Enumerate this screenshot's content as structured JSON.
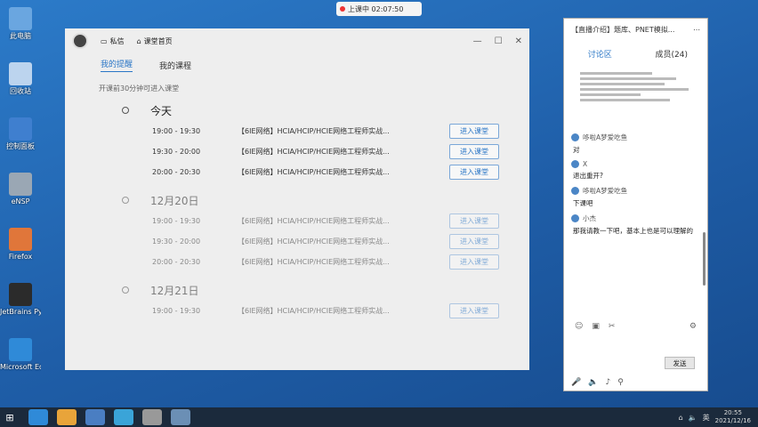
{
  "desktop_icons": [
    {
      "label": "此电脑",
      "color": "#6aa6e0"
    },
    {
      "label": "回收站",
      "color": "#bcd4ee"
    },
    {
      "label": "控制面板",
      "color": "#3f7fcf"
    },
    {
      "label": "eNSP",
      "color": "#9aa7b4"
    },
    {
      "label": "Firefox",
      "color": "#e0763a"
    },
    {
      "label": "JetBrains PyChar...",
      "color": "#2b2b2b"
    },
    {
      "label": "Microsoft Edge",
      "color": "#2f8ad8"
    }
  ],
  "live_indicator": {
    "text": "上课中 02:07:50"
  },
  "app": {
    "title_items": [
      {
        "icon": "message-icon",
        "label": "私信"
      },
      {
        "icon": "home-icon",
        "label": "课堂首页"
      }
    ],
    "tabs": [
      {
        "label": "我的提醒",
        "active": true
      },
      {
        "label": "我的课程",
        "active": false
      }
    ],
    "notice": "开课前30分钟可进入课堂",
    "enter_label": "进入课堂",
    "days": [
      {
        "title": "今天",
        "faded": false,
        "sessions": [
          {
            "time": "19:00 - 19:30",
            "title": "【6IE网络】HCIA/HCIP/HCIE网络工程师实战..."
          },
          {
            "time": "19:30 - 20:00",
            "title": "【6IE网络】HCIA/HCIP/HCIE网络工程师实战..."
          },
          {
            "time": "20:00 - 20:30",
            "title": "【6IE网络】HCIA/HCIP/HCIE网络工程师实战..."
          }
        ]
      },
      {
        "title": "12月20日",
        "faded": true,
        "sessions": [
          {
            "time": "19:00 - 19:30",
            "title": "【6IE网络】HCIA/HCIP/HCIE网络工程师实战..."
          },
          {
            "time": "19:30 - 20:00",
            "title": "【6IE网络】HCIA/HCIP/HCIE网络工程师实战..."
          },
          {
            "time": "20:00 - 20:30",
            "title": "【6IE网络】HCIA/HCIP/HCIE网络工程师实战..."
          }
        ]
      },
      {
        "title": "12月21日",
        "faded": true,
        "sessions": [
          {
            "time": "19:00 - 19:30",
            "title": "【6IE网络】HCIA/HCIP/HCIE网络工程师实战..."
          }
        ]
      }
    ]
  },
  "chat": {
    "header_title": "【直播介绍】题库、PNET模拟...",
    "tabs": [
      {
        "label": "讨论区",
        "active": true
      },
      {
        "label": "成员(24)",
        "active": false
      }
    ],
    "messages": [
      {
        "sender": "哆啦A梦爱吃鱼",
        "text": "对"
      },
      {
        "sender": "X",
        "text": "退出重开?"
      },
      {
        "sender": "哆啦A梦爱吃鱼",
        "text": "下课吧"
      },
      {
        "sender": "小杰",
        "text": "那我请教一下吧，基本上也是可以理解的"
      }
    ],
    "send_label": "发送"
  },
  "taskbar": {
    "time": "20:55",
    "date": "2021/12/16",
    "ime": "英"
  }
}
